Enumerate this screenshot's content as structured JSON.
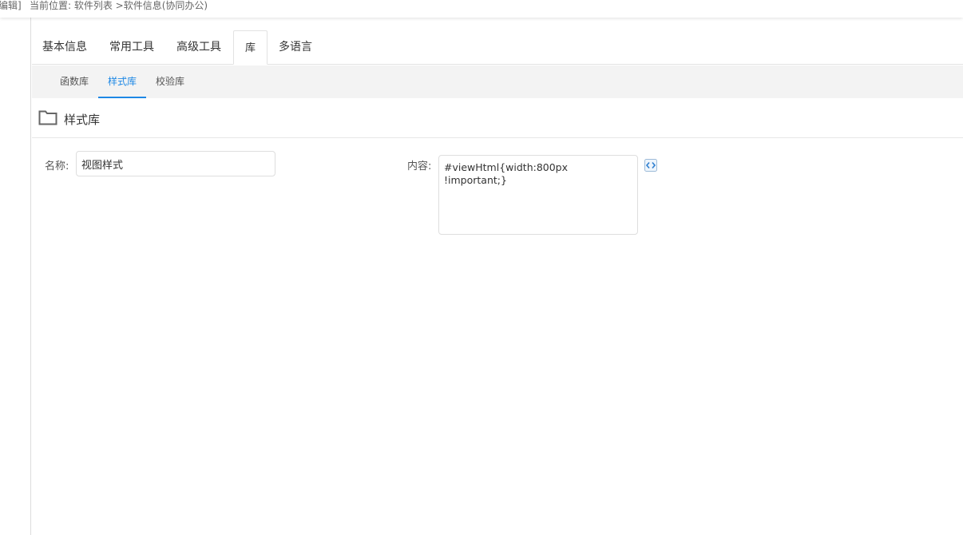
{
  "header": {
    "edit_link": "编辑]",
    "breadcrumb": "当前位置: 软件列表 >软件信息(协同办公)"
  },
  "tabs": [
    {
      "label": "基本信息"
    },
    {
      "label": "常用工具"
    },
    {
      "label": "高级工具"
    },
    {
      "label": "库",
      "active": true
    },
    {
      "label": "多语言"
    }
  ],
  "subtabs": [
    {
      "label": "函数库"
    },
    {
      "label": "样式库",
      "active": true
    },
    {
      "label": "校验库"
    }
  ],
  "section": {
    "title": "样式库",
    "icon": "folder-icon"
  },
  "form": {
    "name_label": "名称:",
    "name_value": "视图样式",
    "content_label": "内容:",
    "content_value": "#viewHtml{width:800px !important;}",
    "content_tool_icon": "code-edit-icon"
  },
  "colors": {
    "accent": "#1e88e5",
    "subtab_bg": "#f3f3f3"
  }
}
